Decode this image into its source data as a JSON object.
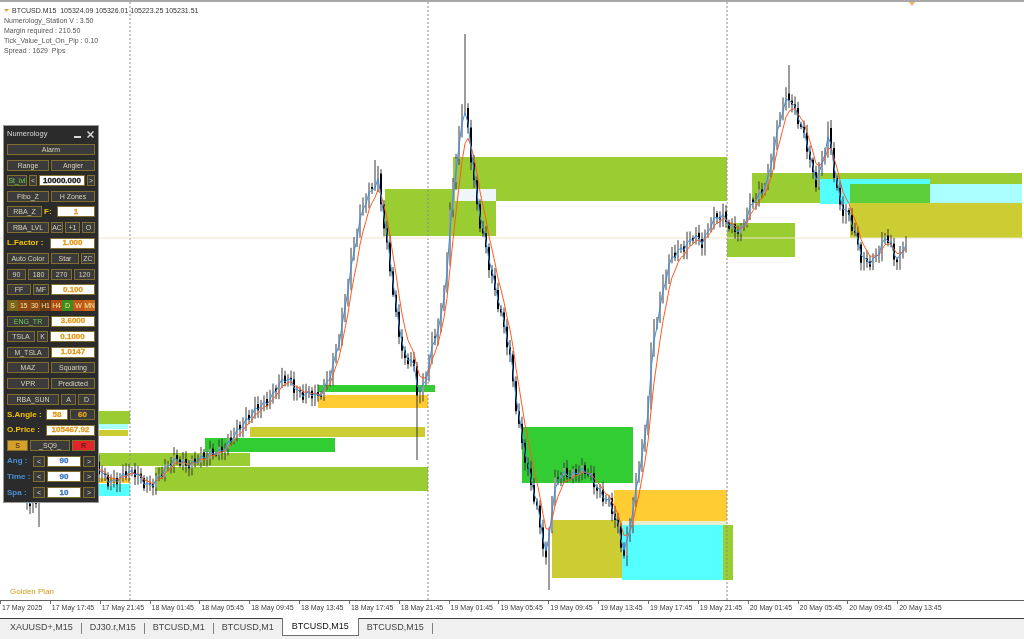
{
  "chart_header": {
    "title": "BTCUSD.M15  105324.09 105326.01 105223.25 105231.51"
  },
  "info_lines": [
    "Numerology_Station V : 3.50",
    "Margin required : 210.50",
    "Tick_Value_Lot_On_Pip : 0.10",
    "Spread : 1629  Pips"
  ],
  "panel": {
    "title": "Numerology",
    "rows": [
      {
        "items": [
          {
            "kind": "button",
            "label": "Alarm",
            "on": false
          }
        ]
      },
      {
        "items": [
          {
            "kind": "button",
            "label": "Range",
            "on": false
          },
          {
            "kind": "button",
            "label": "Angler",
            "on": false
          }
        ]
      },
      {
        "items": [
          {
            "kind": "button",
            "label": "St_lvl",
            "on": true
          },
          {
            "kind": "button",
            "label": "<",
            "on": false
          },
          {
            "kind": "input",
            "value": "10000.000",
            "color": "#202020"
          },
          {
            "kind": "button",
            "label": ">",
            "on": false
          }
        ]
      },
      {
        "items": [
          {
            "kind": "button",
            "label": "Fibo_Z",
            "on": false
          },
          {
            "kind": "button",
            "label": "H Zones",
            "on": false
          }
        ]
      },
      {
        "items": [
          {
            "kind": "button",
            "label": "RBA_Z",
            "on": false
          },
          {
            "kind": "label",
            "text": "F:",
            "color": "#f2c200"
          },
          {
            "kind": "input",
            "value": "1",
            "color": "#e39a1c"
          }
        ]
      },
      {
        "items": [
          {
            "kind": "button",
            "label": "RBA_LVL",
            "on": false
          },
          {
            "kind": "button",
            "label": "AC",
            "on": false
          },
          {
            "kind": "button",
            "label": "+1",
            "on": false
          },
          {
            "kind": "button",
            "label": "O",
            "on": false
          }
        ]
      },
      {
        "items": [
          {
            "kind": "label",
            "text": "L.Factor :",
            "color": "#f2c200"
          },
          {
            "kind": "input",
            "value": "1.000",
            "color": "#e39a1c"
          }
        ]
      },
      {
        "items": [
          {
            "kind": "button",
            "label": "Auto Color",
            "on": false
          },
          {
            "kind": "button",
            "label": "Star",
            "on": false
          },
          {
            "kind": "button",
            "label": "ZC",
            "on": false
          }
        ]
      },
      {
        "items": [
          {
            "kind": "button",
            "label": "90",
            "on": false
          },
          {
            "kind": "button",
            "label": "180",
            "on": false
          },
          {
            "kind": "button",
            "label": "270",
            "on": false
          },
          {
            "kind": "button",
            "label": "120",
            "on": false
          }
        ]
      },
      {
        "items": [
          {
            "kind": "button",
            "label": "FF",
            "on": false
          },
          {
            "kind": "button",
            "label": "MF",
            "on": false
          },
          {
            "kind": "input",
            "value": "0.100",
            "color": "#e39a1c"
          }
        ]
      },
      {
        "items": [
          {
            "kind": "timeframe",
            "label": "S",
            "color": "#7a6418"
          },
          {
            "kind": "timeframe",
            "label": "15",
            "color": "#8c4a12"
          },
          {
            "kind": "timeframe",
            "label": "30",
            "color": "#8c4a12"
          },
          {
            "kind": "timeframe",
            "label": "H1",
            "color": "#6e3a10"
          },
          {
            "kind": "timeframe",
            "label": "H4",
            "color": "#b24c16"
          },
          {
            "kind": "timeframe",
            "label": "D",
            "color": "#3e8e1e"
          },
          {
            "kind": "timeframe",
            "label": "W",
            "color": "#c4561a"
          },
          {
            "kind": "timeframe",
            "label": "MN",
            "color": "#c86a1e"
          }
        ]
      },
      {
        "items": [
          {
            "kind": "button",
            "label": "ENG_TR",
            "on": true
          },
          {
            "kind": "input",
            "value": "3.6000",
            "color": "#e39a1c"
          }
        ]
      },
      {
        "items": [
          {
            "kind": "button",
            "label": "TSLA",
            "on": false
          },
          {
            "kind": "button",
            "label": "K",
            "on": false
          },
          {
            "kind": "input",
            "value": "0.1000",
            "color": "#e39a1c"
          }
        ]
      },
      {
        "items": [
          {
            "kind": "button",
            "label": "M_TSLA",
            "on": false
          },
          {
            "kind": "input",
            "value": "1.0147",
            "color": "#e39a1c"
          }
        ]
      },
      {
        "items": [
          {
            "kind": "button",
            "label": "MAZ",
            "on": false
          },
          {
            "kind": "button",
            "label": "Squaring",
            "on": false
          }
        ]
      },
      {
        "items": [
          {
            "kind": "button",
            "label": "VPR",
            "on": false
          },
          {
            "kind": "button",
            "label": "Predicted",
            "on": false
          }
        ]
      },
      {
        "items": [
          {
            "kind": "button",
            "label": "RBA_SUN",
            "on": false
          },
          {
            "kind": "button",
            "label": "A",
            "on": false
          },
          {
            "kind": "button",
            "label": "D",
            "on": false
          }
        ]
      },
      {
        "items": [
          {
            "kind": "label",
            "text": "S.Angle :",
            "color": "#f2c200"
          },
          {
            "kind": "input",
            "value": "58",
            "color": "#e39a1c"
          },
          {
            "kind": "button",
            "label": "60",
            "color": "#e8a317"
          }
        ]
      },
      {
        "items": [
          {
            "kind": "label",
            "text": "O.Price :",
            "color": "#f2c200"
          },
          {
            "kind": "input",
            "value": "105467.92",
            "color": "#e39a1c"
          }
        ]
      },
      {
        "items": [
          {
            "kind": "filled_button",
            "label": "S",
            "color": "#d6a12a"
          },
          {
            "kind": "button",
            "label": "_SQ9_",
            "on": false
          },
          {
            "kind": "filled_button",
            "label": "R",
            "color": "#e3242b"
          }
        ]
      },
      {
        "items": [
          {
            "kind": "label",
            "text": "Ang :",
            "color": "#4a8fd8"
          },
          {
            "kind": "button",
            "label": "<",
            "on": false
          },
          {
            "kind": "input",
            "value": "90",
            "color": "#3a6fc0"
          },
          {
            "kind": "button",
            "label": ">",
            "on": false
          }
        ]
      },
      {
        "items": [
          {
            "kind": "label",
            "text": "Time :",
            "color": "#4a8fd8"
          },
          {
            "kind": "button",
            "label": "<",
            "on": false
          },
          {
            "kind": "input",
            "value": "90",
            "color": "#3a6fc0"
          },
          {
            "kind": "button",
            "label": ">",
            "on": false
          }
        ]
      },
      {
        "items": [
          {
            "kind": "label",
            "text": "Spa :",
            "color": "#4a8fd8"
          },
          {
            "kind": "button",
            "label": "<",
            "on": false
          },
          {
            "kind": "input",
            "value": "10",
            "color": "#3a6fc0"
          },
          {
            "kind": "button",
            "label": ">",
            "on": false
          }
        ]
      }
    ]
  },
  "chart_label": "Golden Plan",
  "time_axis": {
    "labels": [
      "17 May 2025",
      "17 May 17:45",
      "17 May 21:45",
      "18 May 01:45",
      "18 May 05:45",
      "18 May 09:45",
      "18 May 13:45",
      "18 May 17:45",
      "18 May 21:45",
      "19 May 01:45",
      "19 May 05:45",
      "19 May 09:45",
      "19 May 13:45",
      "19 May 17:45",
      "19 May 21:45",
      "20 May 01:45",
      "20 May 05:45",
      "20 May 09:45",
      "20 May 13:45"
    ]
  },
  "tabs": [
    {
      "label": "XAUUSD+,M15",
      "selected": false
    },
    {
      "label": "DJ30.r,M15",
      "selected": false
    },
    {
      "label": "BTCUSD,M1",
      "selected": false
    },
    {
      "label": "BTCUSD,M1",
      "selected": false
    },
    {
      "label": "BTCUSD,M15",
      "selected": true
    },
    {
      "label": "BTCUSD,M15",
      "selected": false
    }
  ]
}
